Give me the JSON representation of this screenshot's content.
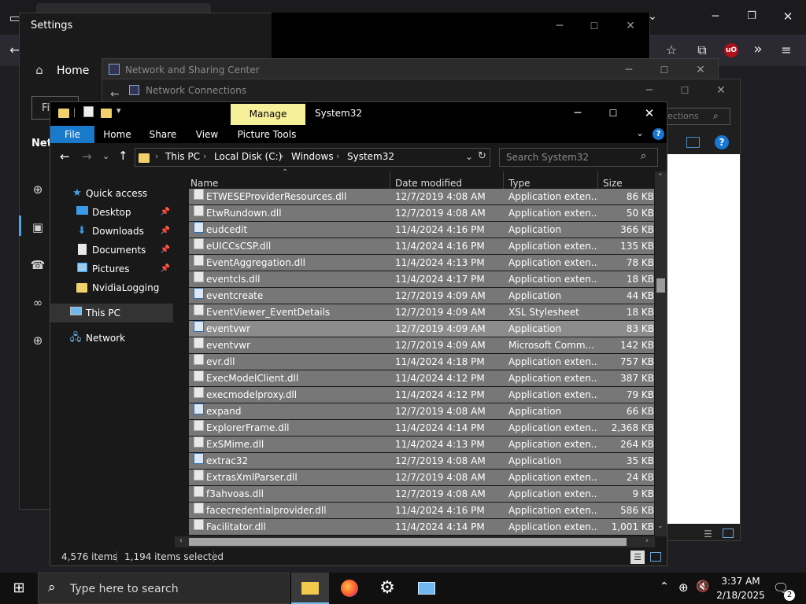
{
  "settings": {
    "title": "Settings",
    "home": "Home",
    "find_stub": "Fi",
    "section_stub": "Net"
  },
  "nsc": {
    "title": "Network and Sharing Center"
  },
  "ncon": {
    "title": "Network Connections",
    "search_stub": "nections"
  },
  "explorer": {
    "title": "System32",
    "manage_tab": "Manage",
    "ribbon_tabs": [
      "File",
      "Home",
      "Share",
      "View",
      "Picture Tools"
    ],
    "breadcrumb": [
      "This PC",
      "Local Disk (C:)",
      "Windows",
      "System32"
    ],
    "search_placeholder": "Search System32",
    "columns": [
      "Name",
      "Date modified",
      "Type",
      "Size"
    ],
    "nav": {
      "quick_access": "Quick access",
      "desktop": "Desktop",
      "downloads": "Downloads",
      "documents": "Documents",
      "pictures": "Pictures",
      "nvidia": "NvidiaLogging",
      "this_pc": "This PC",
      "network": "Network"
    },
    "rows": [
      {
        "name": "ETWESEProviderResources.dll",
        "date": "12/7/2019 4:08 AM",
        "type": "Application exten...",
        "size": "86 KB"
      },
      {
        "name": "EtwRundown.dll",
        "date": "12/7/2019 4:08 AM",
        "type": "Application exten...",
        "size": "50 KB"
      },
      {
        "name": "eudcedit",
        "date": "11/4/2024 4:16 PM",
        "type": "Application",
        "size": "366 KB"
      },
      {
        "name": "eUICCsCSP.dll",
        "date": "11/4/2024 4:16 PM",
        "type": "Application exten...",
        "size": "135 KB"
      },
      {
        "name": "EventAggregation.dll",
        "date": "11/4/2024 4:13 PM",
        "type": "Application exten...",
        "size": "78 KB"
      },
      {
        "name": "eventcls.dll",
        "date": "11/4/2024 4:17 PM",
        "type": "Application exten...",
        "size": "18 KB"
      },
      {
        "name": "eventcreate",
        "date": "12/7/2019 4:09 AM",
        "type": "Application",
        "size": "44 KB"
      },
      {
        "name": "EventViewer_EventDetails",
        "date": "12/7/2019 4:09 AM",
        "type": "XSL Stylesheet",
        "size": "18 KB"
      },
      {
        "name": "eventvwr",
        "date": "12/7/2019 4:09 AM",
        "type": "Application",
        "size": "83 KB"
      },
      {
        "name": "eventvwr",
        "date": "12/7/2019 4:09 AM",
        "type": "Microsoft Comm...",
        "size": "142 KB"
      },
      {
        "name": "evr.dll",
        "date": "11/4/2024 4:18 PM",
        "type": "Application exten...",
        "size": "757 KB"
      },
      {
        "name": "ExecModelClient.dll",
        "date": "11/4/2024 4:12 PM",
        "type": "Application exten...",
        "size": "387 KB"
      },
      {
        "name": "execmodelproxy.dll",
        "date": "11/4/2024 4:12 PM",
        "type": "Application exten...",
        "size": "79 KB"
      },
      {
        "name": "expand",
        "date": "12/7/2019 4:08 AM",
        "type": "Application",
        "size": "66 KB"
      },
      {
        "name": "ExplorerFrame.dll",
        "date": "11/4/2024 4:14 PM",
        "type": "Application exten...",
        "size": "2,368 KB"
      },
      {
        "name": "ExSMime.dll",
        "date": "11/4/2024 4:13 PM",
        "type": "Application exten...",
        "size": "264 KB"
      },
      {
        "name": "extrac32",
        "date": "12/7/2019 4:08 AM",
        "type": "Application",
        "size": "35 KB"
      },
      {
        "name": "ExtrasXmlParser.dll",
        "date": "12/7/2019 4:08 AM",
        "type": "Application exten...",
        "size": "24 KB"
      },
      {
        "name": "f3ahvoas.dll",
        "date": "12/7/2019 4:08 AM",
        "type": "Application exten...",
        "size": "9 KB"
      },
      {
        "name": "facecredentialprovider.dll",
        "date": "11/4/2024 4:16 PM",
        "type": "Application exten...",
        "size": "586 KB"
      },
      {
        "name": "Facilitator.dll",
        "date": "11/4/2024 4:14 PM",
        "type": "Application exten...",
        "size": "1,001 KB"
      }
    ],
    "status": {
      "items": "4,576 items",
      "selected": "1,194 items selected"
    }
  },
  "taskbar": {
    "search_placeholder": "Type here to search",
    "time": "3:37 AM",
    "date": "2/18/2025",
    "notifications": "2"
  },
  "browser": {
    "ublock_label": "uO"
  }
}
